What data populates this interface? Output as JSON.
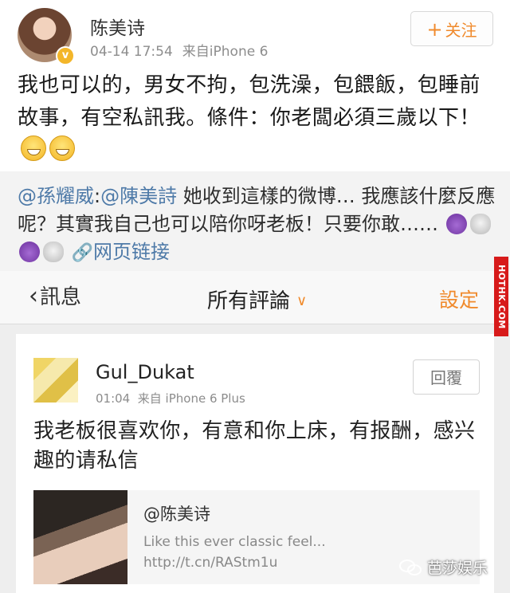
{
  "post": {
    "author": "陈美诗",
    "verified_badge": "v",
    "time": "04-14 17:54",
    "source": "来自iPhone 6",
    "follow_label": "关注",
    "follow_plus": "+",
    "text": "我也可以的，男女不拘，包洗澡，包餵飯，包睡前故事，有空私訊我。條件：你老闆必須三歲以下！"
  },
  "repost": {
    "mention1": "@孫耀威",
    "sep": ":",
    "mention2": "@陳美詩",
    "text": " 她收到這樣的微博… 我應該什麼反應呢？其實我自己也可以陪你呀老板！只要你敢……",
    "link_label": "网页链接"
  },
  "nav": {
    "back_label": "訊息",
    "title": "所有評論",
    "settings_label": "設定"
  },
  "comment": {
    "author": "Gul_Dukat",
    "time": "01:04",
    "source": "来自 iPhone 6 Plus",
    "reply_label": "回覆",
    "text": "我老板很喜欢你，有意和你上床，有报酬，感兴趣的请私信",
    "card": {
      "title": "@陈美诗",
      "desc": "Like this ever classic feel... http://t.cn/RAStm1u"
    }
  },
  "watermarks": {
    "side": "HOTHK.COM",
    "bottom": "芭莎娱乐"
  },
  "colors": {
    "accent_orange": "#f08a2c",
    "link_blue": "#4e7aa8",
    "side_red": "#d71a1a"
  },
  "icons": [
    "verified-badge-icon",
    "grin-emoji-icon",
    "devil-emoji-icon",
    "skull-emoji-icon",
    "link-icon",
    "back-chevron-icon",
    "dropdown-chevron-icon",
    "wechat-icon"
  ]
}
